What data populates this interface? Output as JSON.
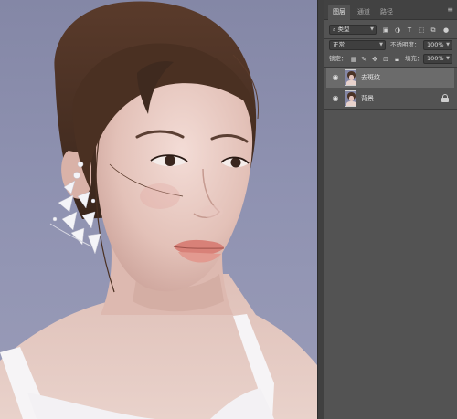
{
  "panel": {
    "tabs": [
      {
        "label": "图层",
        "active": true
      },
      {
        "label": "通道",
        "active": false
      },
      {
        "label": "路径",
        "active": false
      }
    ],
    "menu_icon": "panel-menu-icon",
    "filter_label": "类型",
    "filter_icons": [
      "pixel-filter-icon",
      "adjustment-filter-icon",
      "type-filter-icon",
      "shape-filter-icon",
      "smart-object-filter-icon",
      "filter-toggle-icon"
    ],
    "blend_mode": "正常",
    "opacity_label": "不透明度：",
    "opacity_value": "100%",
    "lock_label": "锁定：",
    "lock_icons": [
      "lock-transparent-icon",
      "lock-paint-icon",
      "lock-position-icon",
      "lock-artboard-icon",
      "lock-all-icon"
    ],
    "fill_label": "填充：",
    "fill_value": "100%",
    "layers": [
      {
        "name": "去斑纹",
        "selected": true,
        "visible": true,
        "locked": false
      },
      {
        "name": "背景",
        "selected": false,
        "visible": true,
        "locked": true
      }
    ]
  },
  "colors": {
    "canvas_background": "#8f92b1",
    "panel_background": "#535353",
    "selected_layer": "#6b6b6b"
  }
}
